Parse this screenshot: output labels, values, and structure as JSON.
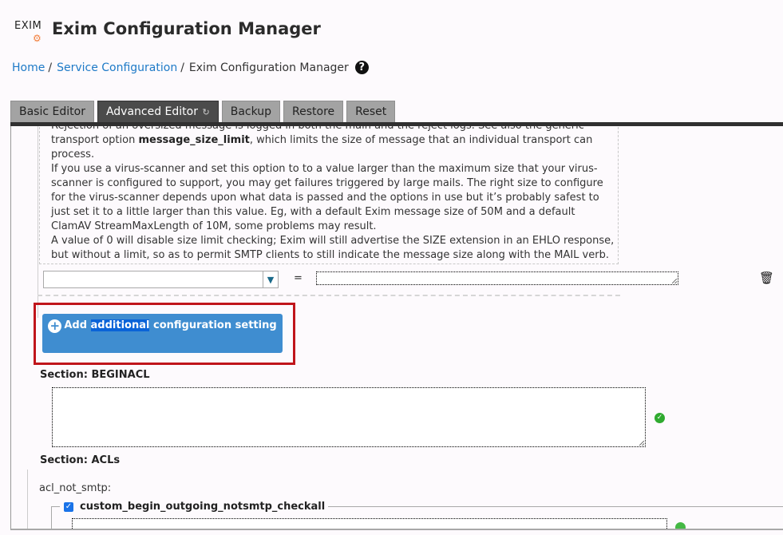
{
  "header": {
    "logo_text": "EXIM",
    "logo_icon": "gear-icon",
    "title": "Exim Configuration Manager"
  },
  "breadcrumb": {
    "items": [
      {
        "label": "Home",
        "link": true
      },
      {
        "label": "Service Configuration",
        "link": true
      },
      {
        "label": "Exim Configuration Manager",
        "link": false
      }
    ],
    "separator": "/",
    "help_icon": "question-circle-icon"
  },
  "tabs": [
    {
      "label": "Basic Editor",
      "active": false
    },
    {
      "label": "Advanced Editor",
      "active": true,
      "icon": "refresh-icon"
    },
    {
      "label": "Backup",
      "active": false
    },
    {
      "label": "Restore",
      "active": false
    },
    {
      "label": "Reset",
      "active": false
    }
  ],
  "doc": {
    "line1": "Rejection of an oversized message is logged in both the main and the reject logs. See also the generic",
    "line2_pre": "transport option ",
    "line2_bold": "message_size_limit",
    "line2_post": ", which limits the size of message that an individual transport can",
    "line3": "process.",
    "para2": "If you use a virus-scanner and set this option to to a value larger than the maximum size that your virus-scanner is configured to support, you may get failures triggered by large mails. The right size to configure for the virus-scanner depends upon what data is passed and the options in use but it’s probably safest to just set it to a little larger than this value. Eg, with a default Exim message size of 50M and a default ClamAV StreamMaxLength of 10M, some problems may result.",
    "para3": "A value of 0 will disable size limit checking; Exim will still advertise the SIZE extension in an EHLO response, but without a limit, so as to permit SMTP clients to still indicate the message size along with the MAIL verb."
  },
  "setting_row": {
    "select_value": "",
    "equals": "=",
    "value": "",
    "delete_icon": "trash-icon"
  },
  "add_button": {
    "pre": "Add ",
    "selected": "additional",
    "post": " configuration setting",
    "icon": "plus-circle-icon"
  },
  "sections": {
    "beginacl_label": "Section: BEGINACL",
    "beginacl_value": "",
    "beginacl_status": "check-circle-icon",
    "acls_label": "Section: ACLs"
  },
  "acl": {
    "name": "acl_not_smtp:",
    "item_label": "custom_begin_outgoing_notsmtp_checkall",
    "item_checked": true
  }
}
